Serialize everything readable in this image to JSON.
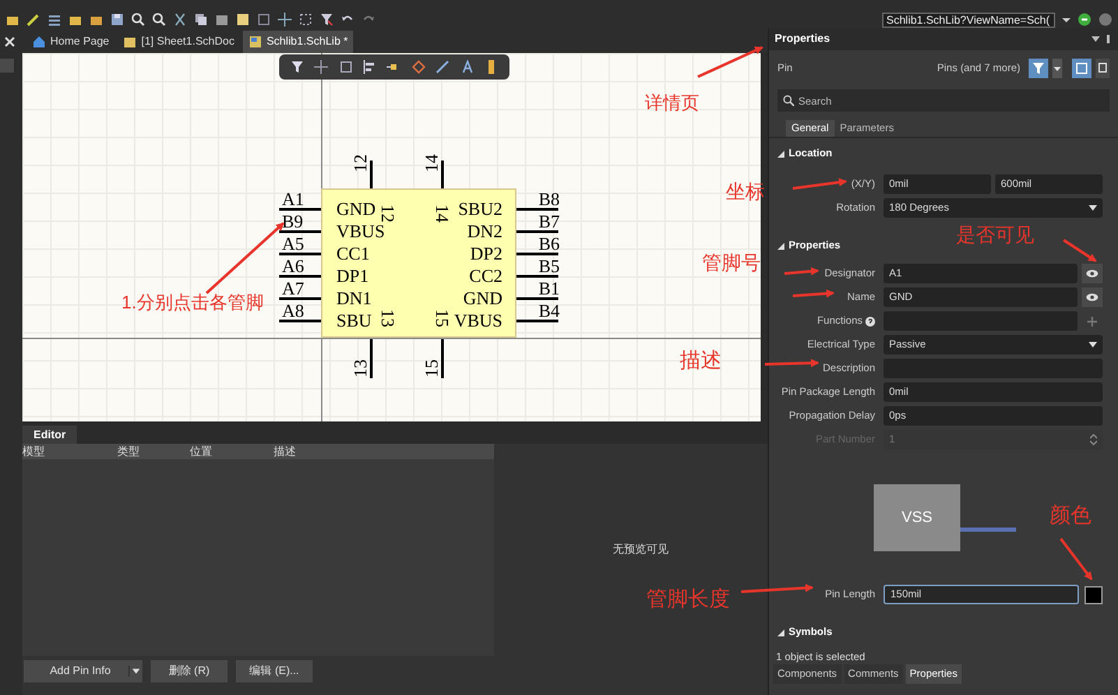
{
  "toolbar": {
    "address": "Schlib1.SchLib?ViewName=Sch("
  },
  "doc_tabs": [
    {
      "label": "Home Page",
      "selected": false,
      "kind": "home"
    },
    {
      "label": "[1] Sheet1.SchDoc",
      "selected": false,
      "kind": "sheet"
    },
    {
      "label": "Schlib1.SchLib *",
      "selected": true,
      "kind": "library"
    }
  ],
  "schematic": {
    "left_pins": [
      {
        "number": "A1",
        "name": "GND"
      },
      {
        "number": "B9",
        "name": "VBUS"
      },
      {
        "number": "A5",
        "name": "CC1"
      },
      {
        "number": "A6",
        "name": "DP1"
      },
      {
        "number": "A7",
        "name": "DN1"
      },
      {
        "number": "A8",
        "name": "SBU"
      }
    ],
    "right_pins": [
      {
        "number": "B8",
        "name": "SBU2"
      },
      {
        "number": "B7",
        "name": "DN2"
      },
      {
        "number": "B6",
        "name": "DP2"
      },
      {
        "number": "B5",
        "name": "CC2"
      },
      {
        "number": "B1",
        "name": "GND"
      },
      {
        "number": "B4",
        "name": "VBUS"
      }
    ],
    "top_pins": [
      {
        "number": "12",
        "inner_label": "12"
      },
      {
        "number": "14",
        "inner_label": "14"
      }
    ],
    "bottom_pins": [
      {
        "number": "13",
        "inner_label": "13"
      },
      {
        "number": "15",
        "inner_label": "15"
      }
    ]
  },
  "editor": {
    "tab": "Editor",
    "columns": [
      "模型",
      "类型",
      "位置",
      "描述"
    ],
    "preview_text": "无预览可见",
    "buttons": [
      {
        "label": "Add Pin Info",
        "kind": "split"
      },
      {
        "label": "删除 (R)",
        "kind": "plain"
      },
      {
        "label": "编辑 (E)...",
        "kind": "plain"
      }
    ]
  },
  "properties": {
    "title": "Properties",
    "object": "Pin",
    "filter_label": "Pins (and 7 more)",
    "search_placeholder": "Search",
    "tabs": [
      {
        "label": "General",
        "selected": true
      },
      {
        "label": "Parameters",
        "selected": false
      }
    ],
    "sections": [
      {
        "title": "Location",
        "rows": [
          {
            "label": "(X/Y)",
            "kind": "pair",
            "values": [
              "0mil",
              "600mil"
            ],
            "disabled": false
          },
          {
            "label": "Rotation",
            "kind": "select",
            "value": "180 Degrees",
            "disabled": false
          }
        ]
      },
      {
        "title": "Properties",
        "rows": [
          {
            "label": "Designator",
            "kind": "visible",
            "value": "A1",
            "disabled": false
          },
          {
            "label": "Name",
            "kind": "visible",
            "value": "GND",
            "disabled": false
          },
          {
            "label": "Functions",
            "kind": "add",
            "help": true,
            "disabled": false
          },
          {
            "label": "Electrical Type",
            "kind": "select",
            "value": "Passive",
            "disabled": false
          },
          {
            "label": "Description",
            "kind": "text",
            "disabled": false
          },
          {
            "label": "Pin Package Length",
            "kind": "text",
            "value": "0mil",
            "disabled": false
          },
          {
            "label": "Propagation Delay",
            "kind": "text",
            "value": "0ps",
            "disabled": false
          },
          {
            "label": "Part Number",
            "kind": "spinner",
            "value": "1",
            "disabled": true
          }
        ]
      }
    ],
    "preview_label": "VSS",
    "pin_length": {
      "label": "Pin Length",
      "value": "150mil",
      "color": "#000000"
    },
    "symbols_title": "Symbols",
    "status": "1 object is selected",
    "panel_tabs": [
      {
        "label": "Components",
        "selected": false
      },
      {
        "label": "Comments",
        "selected": false
      },
      {
        "label": "Properties",
        "selected": true
      }
    ]
  },
  "annotations": [
    {
      "text": "详情页"
    },
    {
      "text": "1.分别点击各管脚"
    },
    {
      "text": "坐标"
    },
    {
      "text": "管脚号"
    },
    {
      "text": "是否可见"
    },
    {
      "text": "描述"
    },
    {
      "text": "颜色"
    },
    {
      "text": "管脚长度"
    }
  ]
}
